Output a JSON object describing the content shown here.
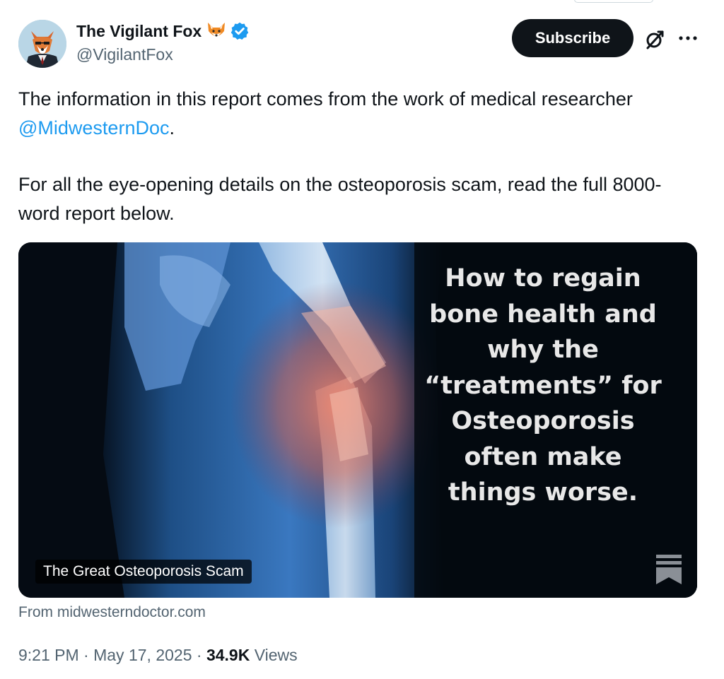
{
  "author": {
    "display_name": "The Vigilant Fox",
    "handle": "@VigilantFox",
    "emoji_icon": "fox-face-icon",
    "verified_icon": "verified-badge-icon",
    "verified_color": "#1d9bf0"
  },
  "actions": {
    "subscribe_label": "Subscribe",
    "grok_icon": "grok-icon",
    "more_icon": "more-options-icon"
  },
  "post": {
    "para1_before": "The information in this report comes from the work of medical researcher ",
    "mention": "@MidwesternDoc",
    "para1_after": ".",
    "para2": "For all the eye-opening details on the osteoporosis scam, read the full 8000-word report below."
  },
  "card": {
    "overlay_lines": [
      "How to regain",
      "bone health and",
      "why the",
      "“treatments” for",
      "Osteoporosis",
      "often make",
      "things worse."
    ],
    "title": "The Great Osteoporosis Scam",
    "source": "From midwesterndoctor.com",
    "brand_icon": "substack-bookmark-icon"
  },
  "meta": {
    "time": "9:21 PM",
    "separator": " · ",
    "date": "May 17, 2025",
    "views_count": "34.9K",
    "views_label": "Views"
  },
  "colors": {
    "text": "#0f1419",
    "secondary": "#536471",
    "link": "#1d9bf0",
    "button_bg": "#0f1419"
  }
}
